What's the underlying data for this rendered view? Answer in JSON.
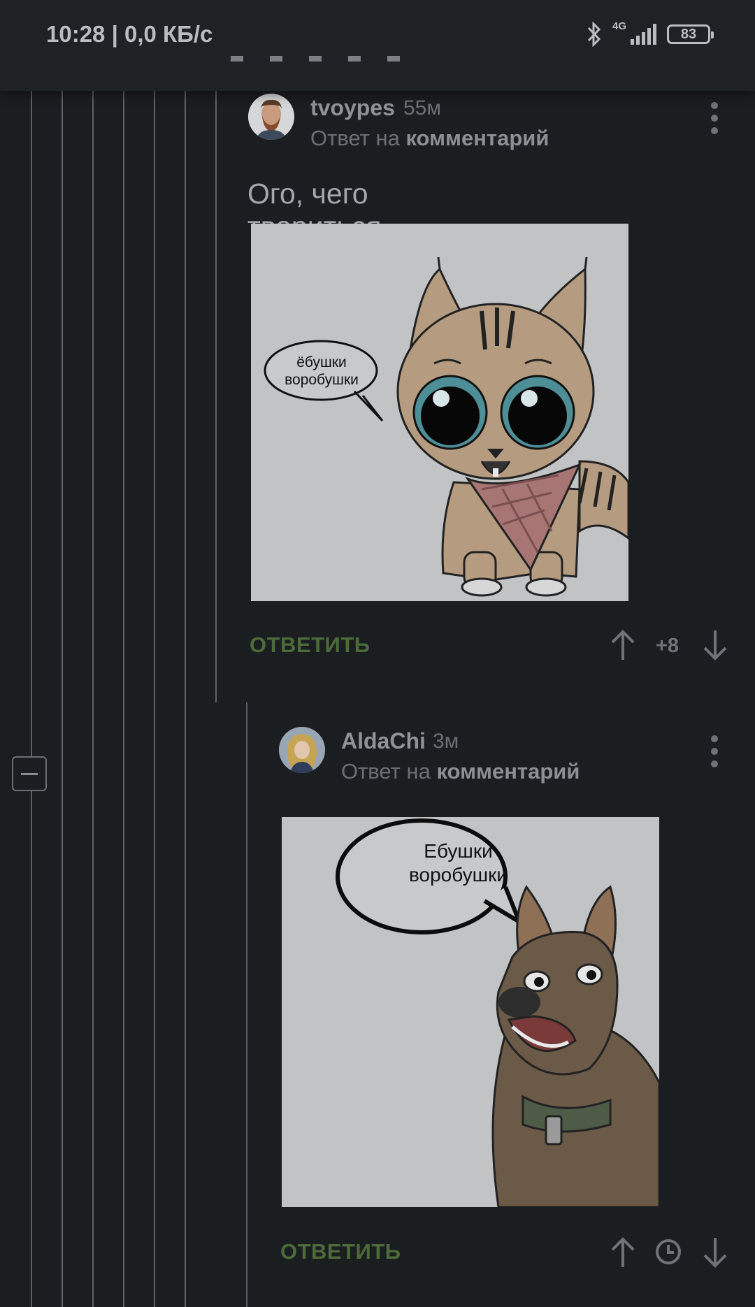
{
  "status_bar": {
    "time": "10:28 | 0,0 КБ/с",
    "network": "4G",
    "battery": "83",
    "icons": [
      "bluetooth-icon",
      "signal-icon",
      "battery-icon"
    ]
  },
  "comments": [
    {
      "username": "tvoypes",
      "time": "55м",
      "reply_prefix": "Ответ на",
      "reply_target": "комментарий",
      "text": "Ого, чего твориться",
      "image": {
        "speech_bubble": "ёбушки\nворобушки",
        "icon": "cartoon-lynx-kitten"
      },
      "reply_label": "ОТВЕТИТЬ",
      "score": "+8"
    },
    {
      "username": "AldaChi",
      "time": "3м",
      "reply_prefix": "Ответ на",
      "reply_target": "комментарий",
      "image": {
        "speech_bubble": "Ебушки\nворобушки",
        "icon": "cartoon-shepherd-dog"
      },
      "reply_label": "ОТВЕТИТЬ",
      "score_icon": "clock-icon"
    }
  ],
  "colors": {
    "background": "#1b1e21",
    "reply_green": "#4d6a39",
    "thread_line": "#5e6266"
  }
}
